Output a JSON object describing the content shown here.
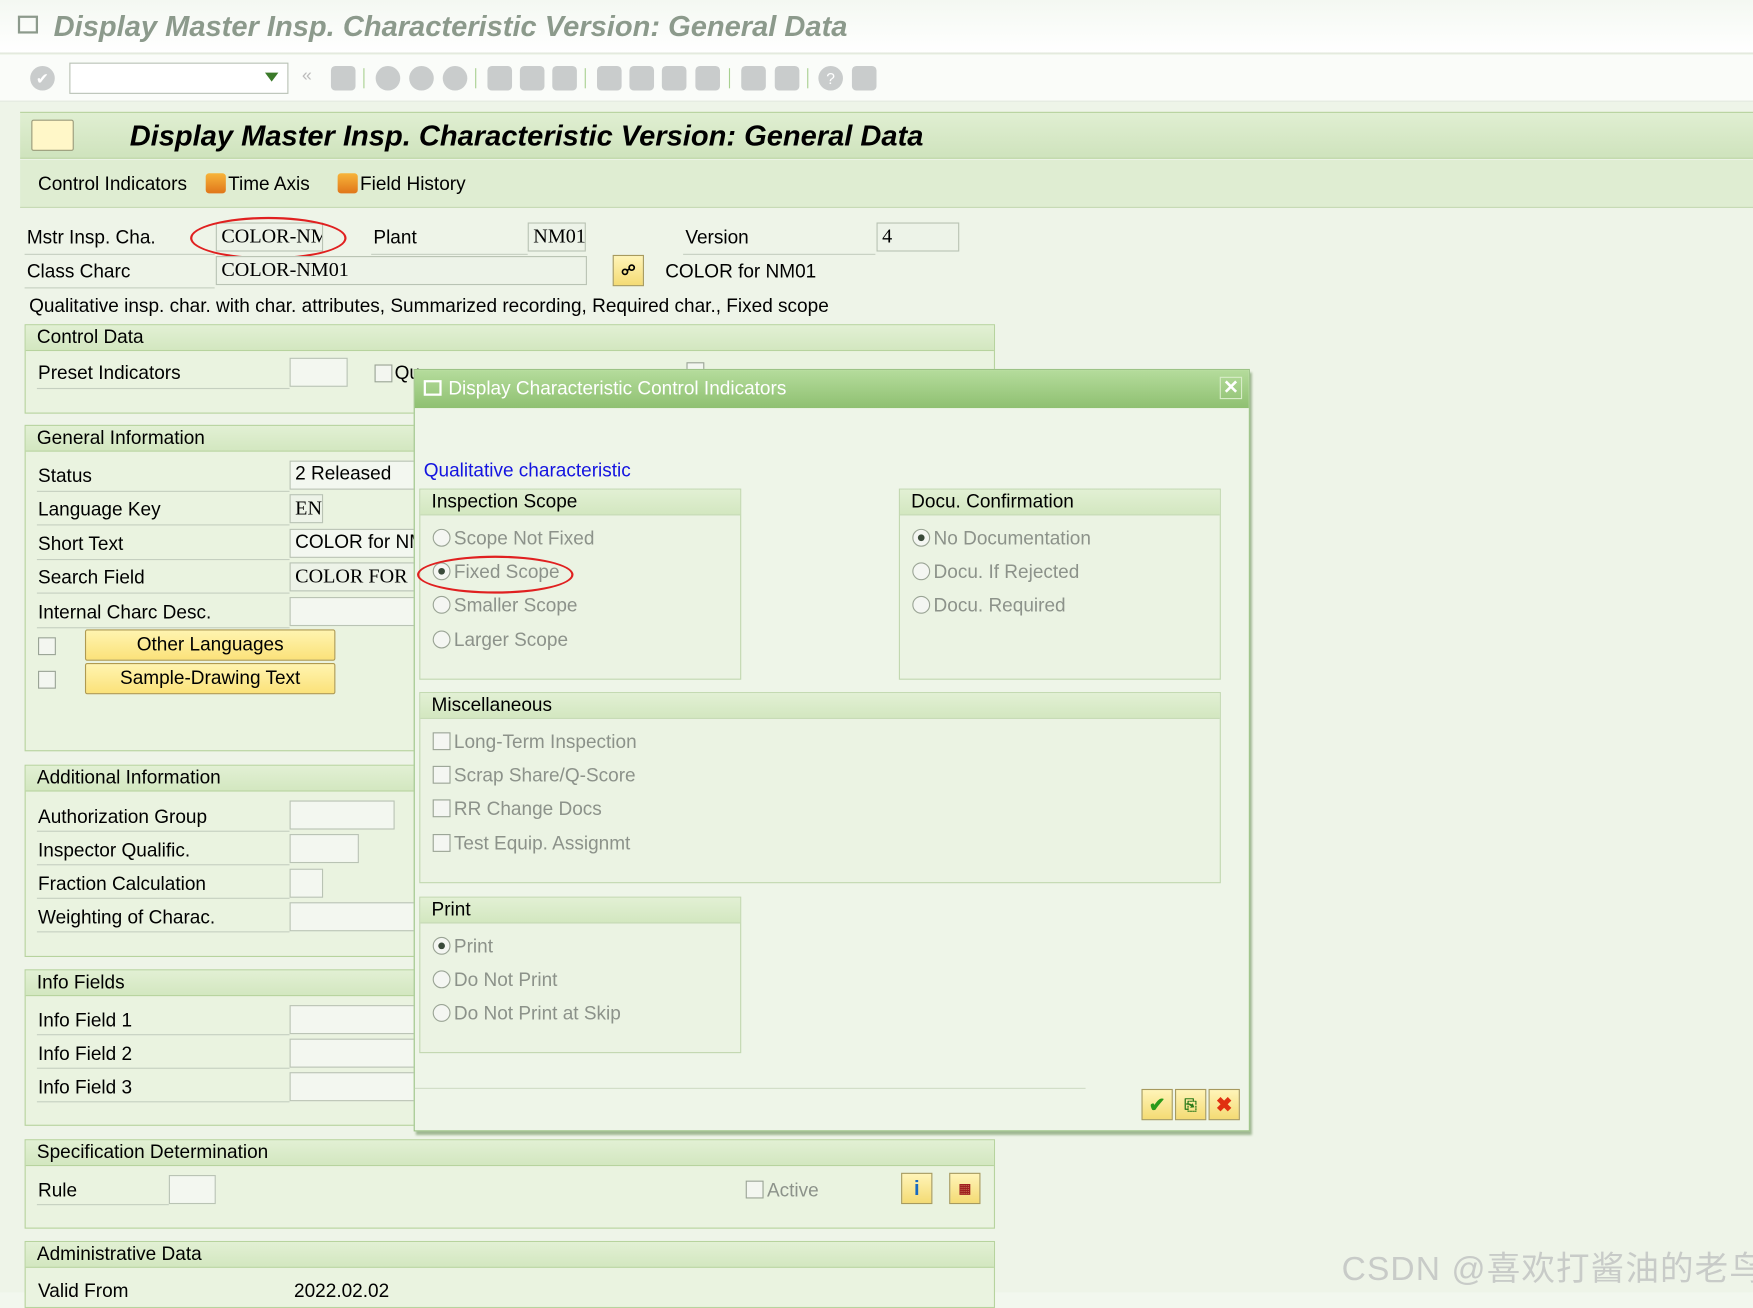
{
  "window": {
    "title": "Display Master Insp. Characteristic Version: General Data"
  },
  "system_toolbar": {
    "command_field_value": "",
    "icons": [
      "enter-icon",
      "save-icon",
      "back-icon",
      "exit-icon",
      "cancel-icon",
      "print-icon",
      "find-icon",
      "find-next-icon",
      "first-page-icon",
      "previous-page-icon",
      "next-page-icon",
      "last-page-icon",
      "create-session-icon",
      "shortcut-icon",
      "help-icon",
      "customize-layout-icon"
    ]
  },
  "header": {
    "title": "Display Master Insp. Characteristic Version: General Data"
  },
  "app_toolbar": {
    "control_indicators": "Control Indicators",
    "time_axis": "Time Axis",
    "field_history": "Field History"
  },
  "fields": {
    "mstr_label": "Mstr Insp. Cha.",
    "mstr_value": "COLOR-NM",
    "plant_label": "Plant",
    "plant_value": "NM01",
    "version_label": "Version",
    "version_value": "4",
    "class_label": "Class Charc",
    "class_value": "COLOR-NM01",
    "class_desc": "COLOR for NM01",
    "description": "Qualitative insp. char. with char. attributes, Summarized recording, Required char., Fixed scope"
  },
  "control_data": {
    "title": "Control Data",
    "preset_label": "Preset Indicators",
    "preset_value": "",
    "partial_check_1": "Qu",
    "partial_check_2": ""
  },
  "general_info": {
    "title": "General Information",
    "status_label": "Status",
    "status_value": "2 Released",
    "lang_label": "Language Key",
    "lang_value": "EN",
    "short_label": "Short Text",
    "short_value": "COLOR for NM",
    "search_label": "Search Field",
    "search_value": "COLOR FOR",
    "internal_label": "Internal Charc Desc.",
    "internal_value": "",
    "other_languages": "Other Languages",
    "sample_drawing": "Sample-Drawing Text"
  },
  "additional_info": {
    "title": "Additional Information",
    "auth_label": "Authorization Group",
    "inspector_label": "Inspector Qualific.",
    "fraction_label": "Fraction Calculation",
    "weighting_label": "Weighting of Charac."
  },
  "info_fields": {
    "title": "Info Fields",
    "f1": "Info Field 1",
    "f2": "Info Field 2",
    "f3": "Info Field 3"
  },
  "spec": {
    "title": "Specification Determination",
    "rule_label": "Rule",
    "active_label": "Active"
  },
  "admin": {
    "title": "Administrative Data",
    "valid_from_label": "Valid From",
    "valid_from_value": "2022.02.02"
  },
  "dialog": {
    "title": "Display Characteristic Control Indicators",
    "subtitle": "Qualitative characteristic",
    "inspection_scope": {
      "title": "Inspection Scope",
      "options": [
        "Scope Not Fixed",
        "Fixed Scope",
        "Smaller Scope",
        "Larger Scope"
      ],
      "selected": "Fixed Scope"
    },
    "docu": {
      "title": "Docu. Confirmation",
      "options": [
        "No Documentation",
        "Docu. If Rejected",
        "Docu. Required"
      ],
      "selected": "No Documentation"
    },
    "misc": {
      "title": "Miscellaneous",
      "options": [
        "Long-Term Inspection",
        "Scrap Share/Q-Score",
        "RR Change Docs",
        "Test Equip. Assignmt"
      ],
      "checked": []
    },
    "print": {
      "title": "Print",
      "options": [
        "Print",
        "Do Not Print",
        "Do Not Print at Skip"
      ],
      "selected": "Print"
    }
  },
  "annotation_color": "#e02020",
  "watermark": "CSDN @喜欢打酱油的老鸟"
}
